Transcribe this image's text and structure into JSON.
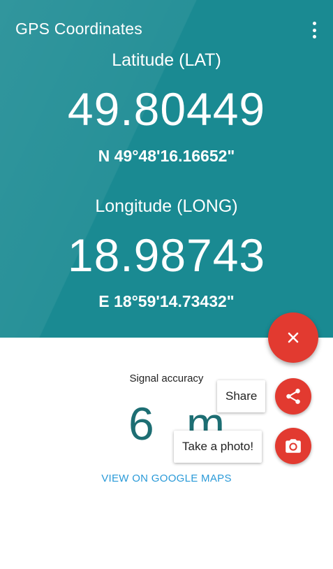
{
  "app": {
    "title": "GPS Coordinates",
    "menu_icon": "more-vert-icon"
  },
  "latitude": {
    "label": "Latitude (LAT)",
    "decimal": "49.80449",
    "dms": "N 49°48'16.16652\""
  },
  "longitude": {
    "label": "Longitude (LONG)",
    "decimal": "18.98743",
    "dms": "E 18°59'14.73432\""
  },
  "accuracy": {
    "label": "Signal accuracy",
    "value": "6 m"
  },
  "maps_link": "VIEW ON GOOGLE MAPS",
  "fab": {
    "main_icon": "close-icon",
    "actions": [
      {
        "label": "Share",
        "icon": "share-icon"
      },
      {
        "label": "Take a photo!",
        "icon": "camera-icon"
      }
    ]
  },
  "colors": {
    "header": "#1a8a92",
    "fab": "#e23a30",
    "link": "#2a9ad8",
    "accuracy": "#1d6e73"
  }
}
